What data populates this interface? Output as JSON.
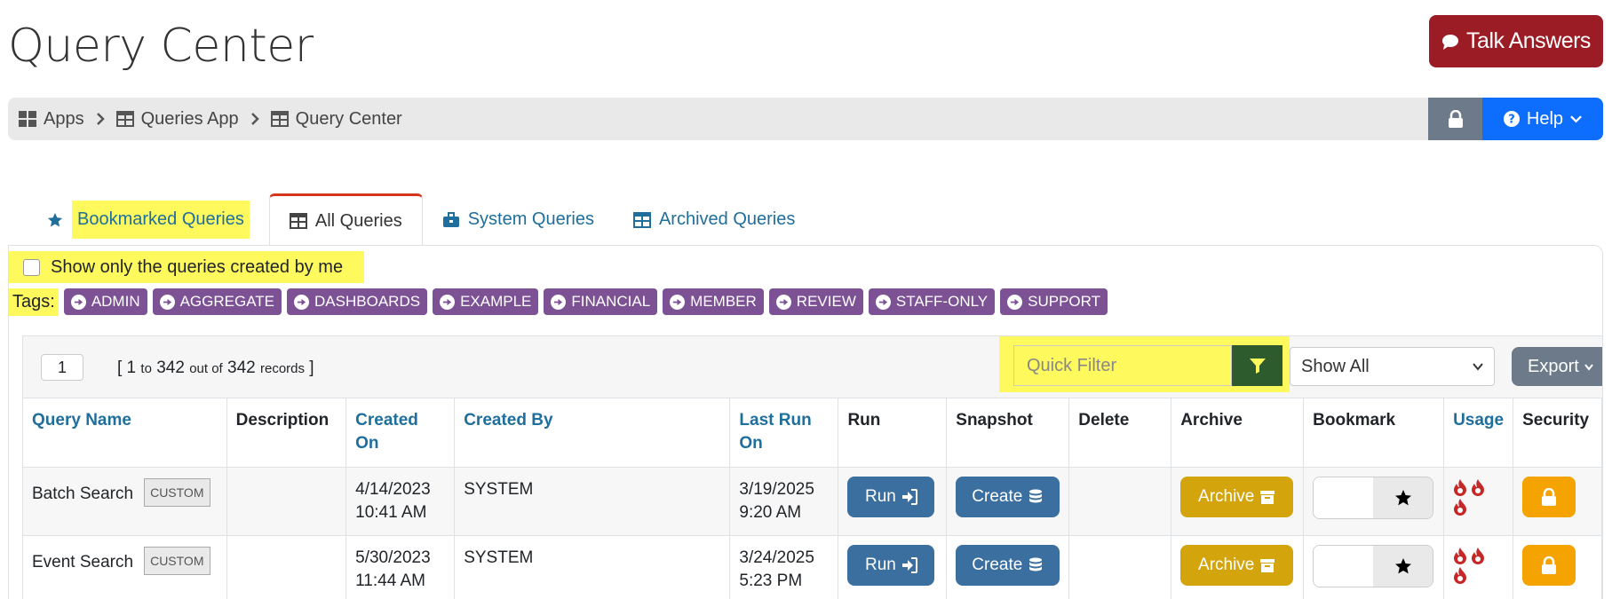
{
  "header": {
    "title": "Query Center",
    "talk_button": "Talk Answers"
  },
  "breadcrumb": {
    "items": [
      {
        "label": "Apps",
        "icon": "grid-icon"
      },
      {
        "label": "Queries App",
        "icon": "table-icon"
      },
      {
        "label": "Query Center",
        "icon": "table-icon"
      }
    ],
    "help_label": "Help"
  },
  "tabs": [
    {
      "label": "Bookmarked Queries",
      "icon": "star-icon"
    },
    {
      "label": "All Queries",
      "icon": "table-icon",
      "active": true
    },
    {
      "label": "System Queries",
      "icon": "briefcase-icon"
    },
    {
      "label": "Archived Queries",
      "icon": "table-icon"
    }
  ],
  "filters": {
    "show_mine_label": "Show only the queries created by me",
    "tags_label": "Tags:",
    "tags": [
      "ADMIN",
      "AGGREGATE",
      "DASHBOARDS",
      "EXAMPLE",
      "FINANCIAL",
      "MEMBER",
      "REVIEW",
      "STAFF-ONLY",
      "SUPPORT"
    ]
  },
  "toolbar": {
    "page": "1",
    "records_open": "[ 1",
    "records_to": "to",
    "records_end": "342",
    "records_outof": "out of",
    "records_total": "342",
    "records_word": "records",
    "records_close": "]",
    "quick_filter_placeholder": "Quick Filter",
    "show_select": "Show All",
    "export_label": "Export"
  },
  "table": {
    "headers": {
      "query_name": "Query Name",
      "description": "Description",
      "created_on": "Created On",
      "created_by": "Created By",
      "last_run_on": "Last Run On",
      "run": "Run",
      "snapshot": "Snapshot",
      "delete": "Delete",
      "archive": "Archive",
      "bookmark": "Bookmark",
      "usage": "Usage",
      "security": "Security"
    },
    "rows": [
      {
        "name": "Batch Search",
        "badge": "CUSTOM",
        "description": "",
        "created_date": "4/14/2023",
        "created_time": "10:41 AM",
        "created_by": "SYSTEM",
        "last_run_date": "3/19/2025",
        "last_run_time": "9:20 AM",
        "run_label": "Run",
        "create_label": "Create",
        "archive_label": "Archive"
      },
      {
        "name": "Event Search",
        "badge": "CUSTOM",
        "description": "",
        "created_date": "5/30/2023",
        "created_time": "11:44 AM",
        "created_by": "SYSTEM",
        "last_run_date": "3/24/2025",
        "last_run_time": "5:23 PM",
        "run_label": "Run",
        "create_label": "Create",
        "archive_label": "Archive"
      }
    ]
  },
  "colors": {
    "talk": "#9b1c24",
    "help": "#0d6efd",
    "tag": "#7c5295",
    "run": "#3b6fa0",
    "archive": "#d4a40c",
    "security": "#f5a300",
    "highlight": "#fef95d",
    "active_tab_border": "#d7351c"
  }
}
